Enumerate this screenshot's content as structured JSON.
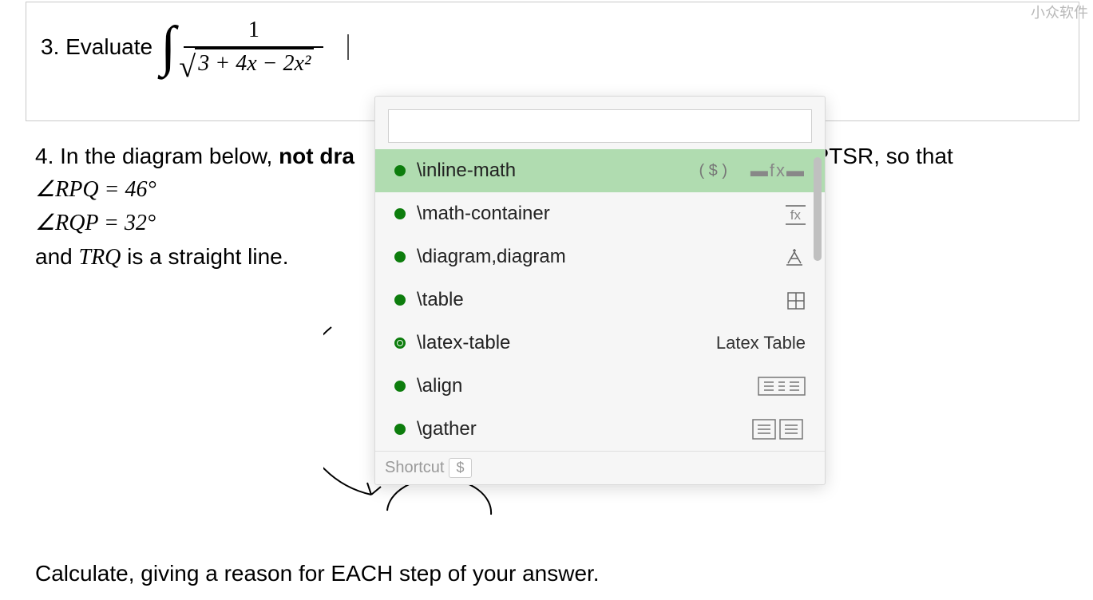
{
  "watermark": "小众软件",
  "q3": {
    "prefix": "3. Evaluate",
    "numerator": "1",
    "radicand": "3 + 4x − 2x²"
  },
  "q4": {
    "line1a": "4. In the diagram below, ",
    "bold": "not dra",
    "line1b": "PTSR, so that",
    "angle1": "∠RPQ = 46°",
    "angle2": "∠RQP = 32°",
    "line3": "and TRQ is a straight line."
  },
  "bottom": "Calculate, giving a reason for EACH step of your answer.",
  "popup": {
    "search_placeholder": "",
    "items": [
      {
        "label": "\\inline-math",
        "hint": "( $ )",
        "icon": "fx-dash",
        "selected": true
      },
      {
        "label": "\\math-container",
        "hint": "",
        "icon": "fx-box"
      },
      {
        "label": "\\diagram,diagram",
        "hint": "",
        "icon": "diagram"
      },
      {
        "label": "\\table",
        "hint": "",
        "icon": "table"
      },
      {
        "label": "\\latex-table",
        "hint": "",
        "icon": "latex-table",
        "ring": true
      },
      {
        "label": "\\align",
        "hint": "",
        "icon": "align"
      },
      {
        "label": "\\gather",
        "hint": "",
        "icon": "gather"
      }
    ],
    "latex_table_text": "Latex Table",
    "footer_label": "Shortcut",
    "footer_key": "$"
  }
}
